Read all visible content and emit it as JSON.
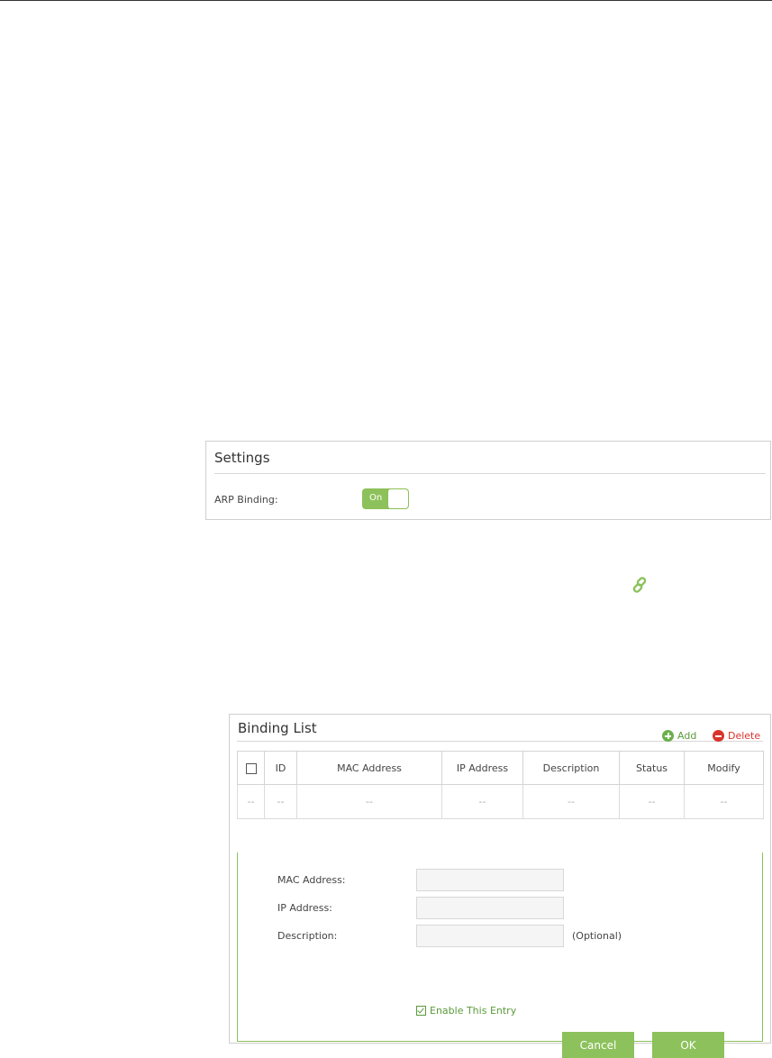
{
  "settings": {
    "title": "Settings",
    "arp_label": "ARP Binding:",
    "toggle_label": "On",
    "toggle_state": "on"
  },
  "binding_list": {
    "title": "Binding List",
    "add_label": "Add",
    "delete_label": "Delete",
    "columns": [
      "ID",
      "MAC Address",
      "IP Address",
      "Description",
      "Status",
      "Modify"
    ],
    "row": [
      "--",
      "--",
      "--",
      "--",
      "--",
      "--",
      "--"
    ],
    "form": {
      "mac_label": "MAC Address:",
      "ip_label": "IP Address:",
      "desc_label": "Description:",
      "optional_text": "(Optional)",
      "enable_label": "Enable This Entry",
      "cancel_label": "Cancel",
      "ok_label": "OK"
    }
  },
  "colors": {
    "accent_green": "#8cc15b",
    "delete_red": "#d9342b"
  },
  "icons": [
    "link-icon",
    "add-icon",
    "delete-icon",
    "checkbox-icon"
  ]
}
